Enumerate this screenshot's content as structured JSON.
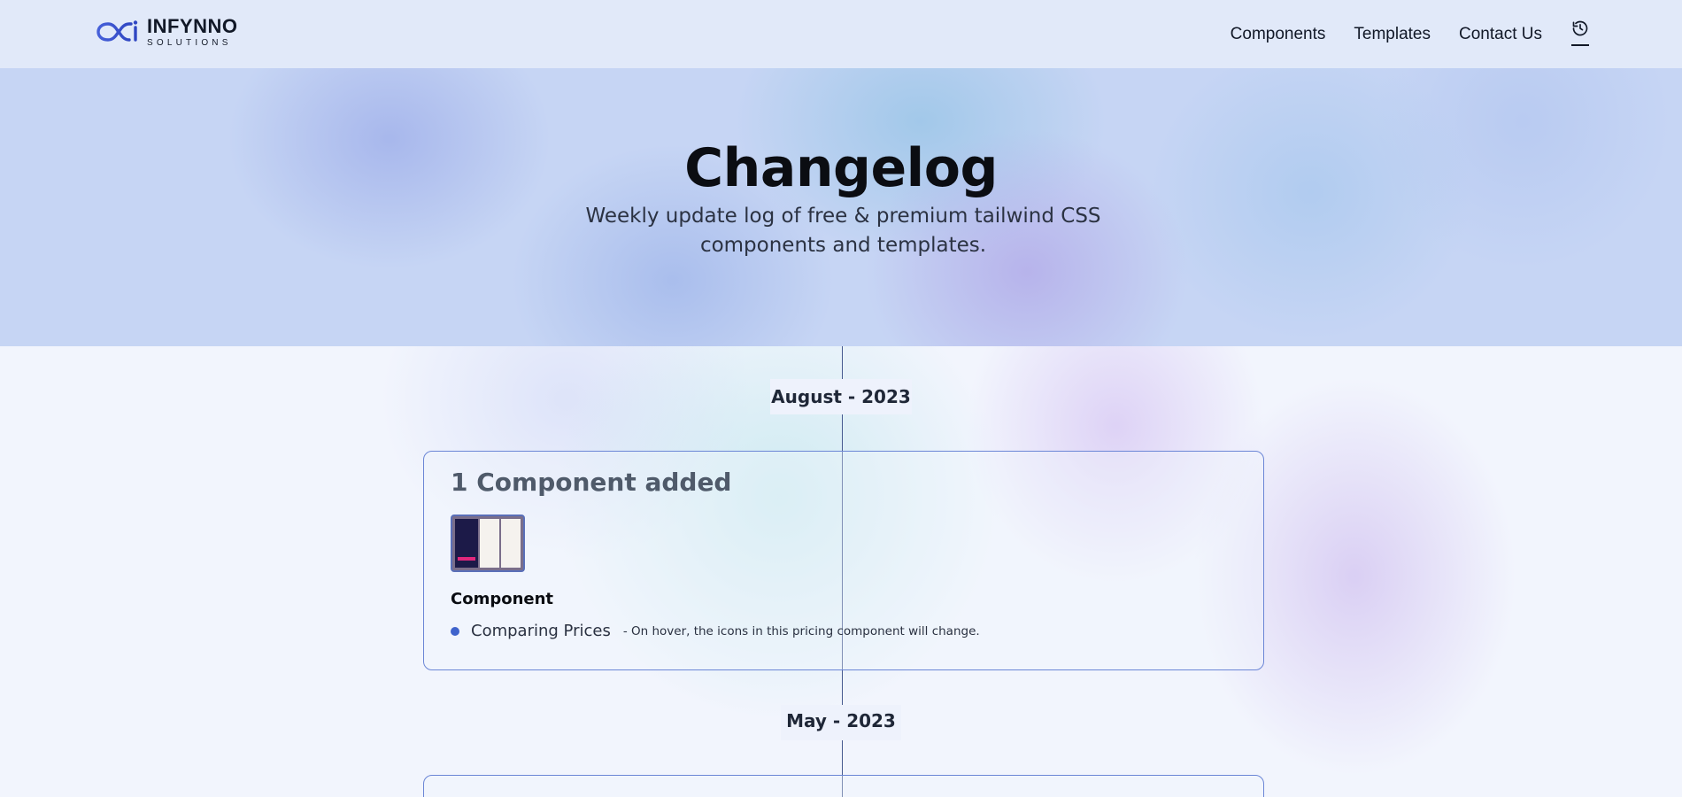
{
  "header": {
    "logo": {
      "name": "INFYNNO",
      "sub": "SOLUTIONS"
    },
    "nav": [
      {
        "label": "Components"
      },
      {
        "label": "Templates"
      },
      {
        "label": "Contact Us"
      }
    ],
    "history_icon": "history-icon"
  },
  "hero": {
    "title": "Changelog",
    "subtitle": "Weekly update log of free & premium tailwind CSS components and templates."
  },
  "timeline": [
    {
      "month": "August - 2023",
      "title": "1 Component added",
      "section": "Component",
      "items": [
        {
          "name": "Comparing Prices",
          "description": "- On hover, the icons in this pricing component will change."
        }
      ]
    },
    {
      "month": "May - 2023"
    }
  ],
  "colors": {
    "accent": "#3f63cc",
    "card_border": "#6b86d6",
    "header_bg": "#e1e9f9",
    "timeline_line": "#46598f"
  }
}
